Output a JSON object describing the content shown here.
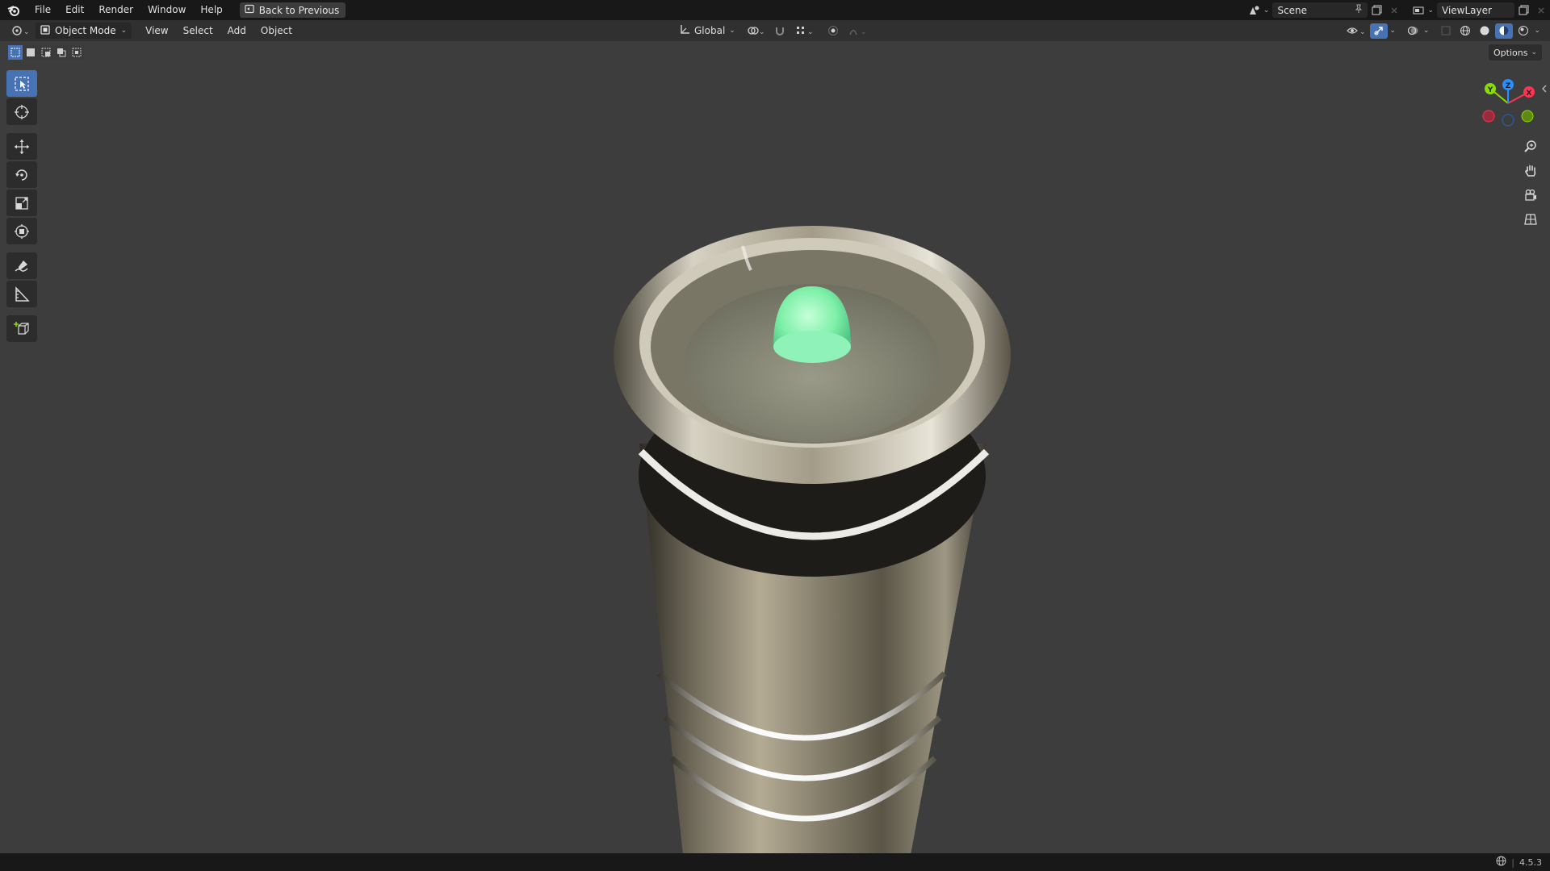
{
  "topbar": {
    "menus": [
      "File",
      "Edit",
      "Render",
      "Window",
      "Help"
    ],
    "back_label": "Back to Previous",
    "scene_name": "Scene",
    "view_layer": "ViewLayer"
  },
  "header": {
    "mode": "Object Mode",
    "menus": [
      "View",
      "Select",
      "Add",
      "Object"
    ],
    "orientation": "Global"
  },
  "viewport": {
    "options_label": "Options",
    "gizmo_axes": [
      "X",
      "Y",
      "Z"
    ]
  },
  "status": {
    "version": "4.5.3"
  },
  "colors": {
    "accent": "#4772b3",
    "axis_x": "#ff3352",
    "axis_y": "#8bdc00",
    "axis_z": "#2890ff"
  }
}
